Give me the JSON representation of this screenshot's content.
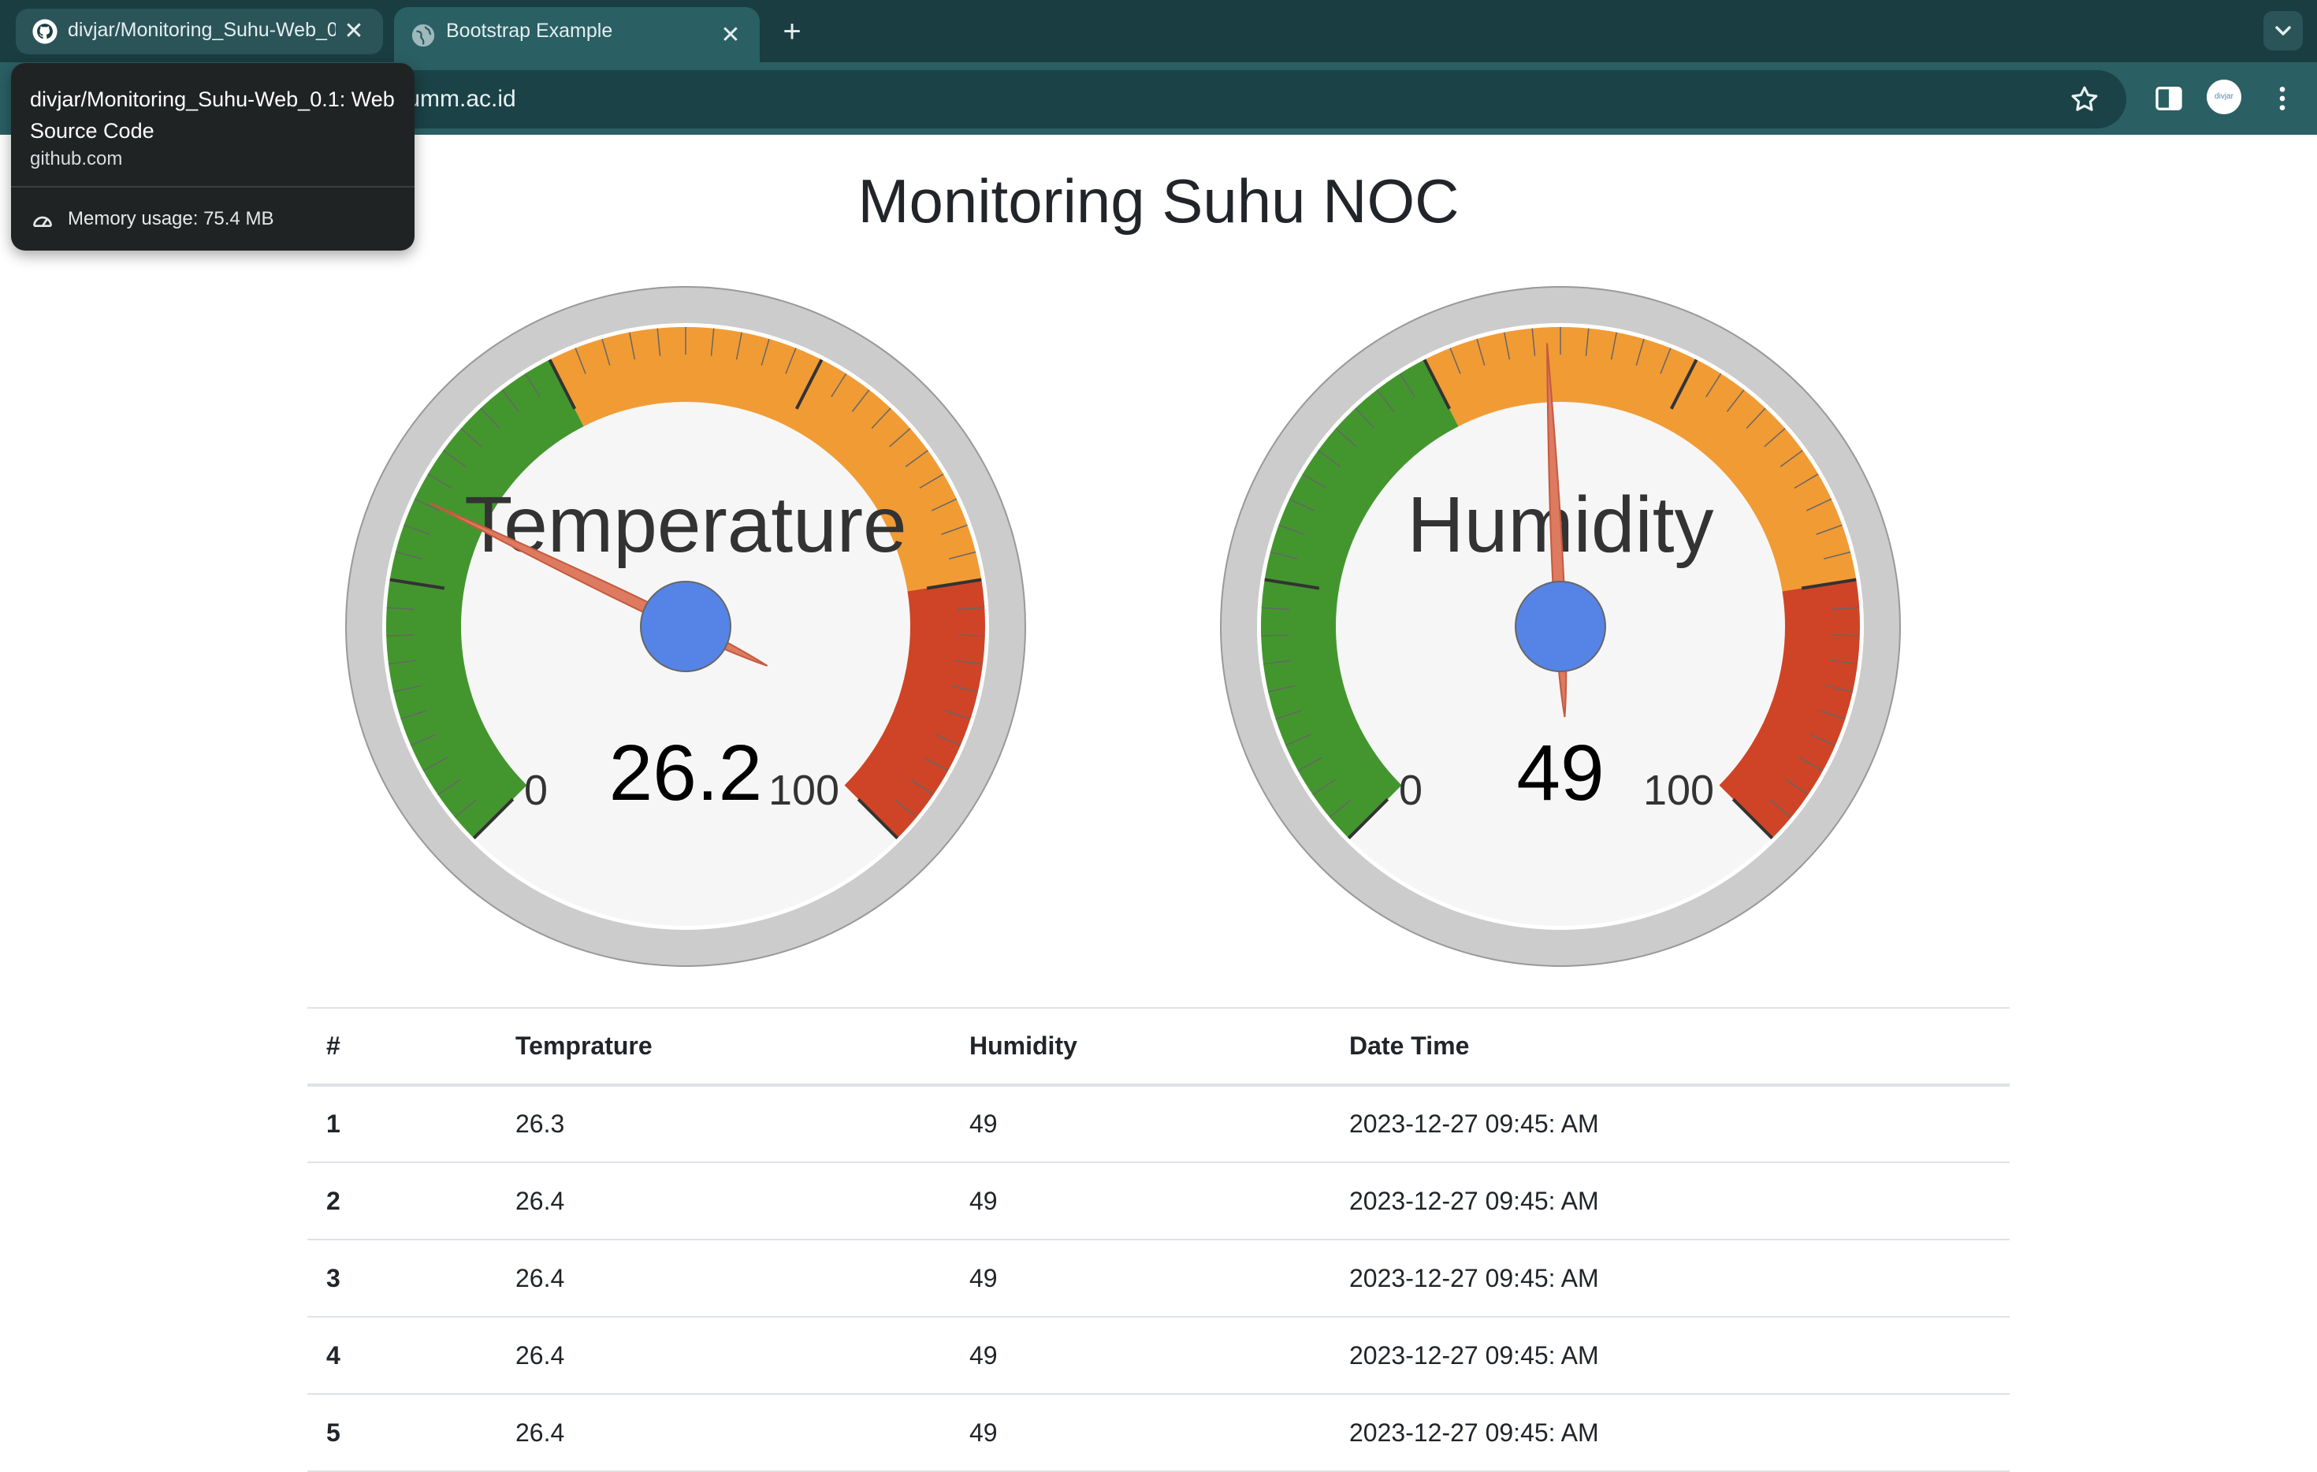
{
  "browser": {
    "tabs": [
      {
        "title": "divjar/Monitoring_Suhu-Web_0.1: Web Source Code",
        "icon": "github-icon",
        "active": false
      },
      {
        "title": "Bootstrap Example",
        "icon": "globe-icon",
        "active": true
      }
    ],
    "new_tab": "+",
    "address": ".umm.ac.id",
    "avatar_text": "divjar"
  },
  "hovercard": {
    "title": "divjar/Monitoring_Suhu-Web_0.1: Web Source Code",
    "domain": "github.com",
    "memory": "Memory usage: 75.4 MB"
  },
  "page": {
    "title": "Monitoring Suhu NOC"
  },
  "gauges": [
    {
      "label": "Temperature",
      "value": 26.2,
      "value_text": "26.2",
      "min": 0,
      "max": 100,
      "min_text": "0",
      "max_text": "100"
    },
    {
      "label": "Humidity",
      "value": 49,
      "value_text": "49",
      "min": 0,
      "max": 100,
      "min_text": "0",
      "max_text": "100"
    }
  ],
  "colors": {
    "green_zone": "#43962e",
    "yellow_zone": "#f19b35",
    "red_zone": "#cf4426",
    "needle": "#dd7a5f",
    "hub": "#5584e6",
    "bezel": "#cccccc",
    "face": "#f6f6f6"
  },
  "table": {
    "headers": [
      "#",
      "Temprature",
      "Humidity",
      "Date Time"
    ],
    "rows": [
      [
        "1",
        "26.3",
        "49",
        "2023-12-27 09:45: AM"
      ],
      [
        "2",
        "26.4",
        "49",
        "2023-12-27 09:45: AM"
      ],
      [
        "3",
        "26.4",
        "49",
        "2023-12-27 09:45: AM"
      ],
      [
        "4",
        "26.4",
        "49",
        "2023-12-27 09:45: AM"
      ],
      [
        "5",
        "26.4",
        "49",
        "2023-12-27 09:45: AM"
      ]
    ]
  }
}
